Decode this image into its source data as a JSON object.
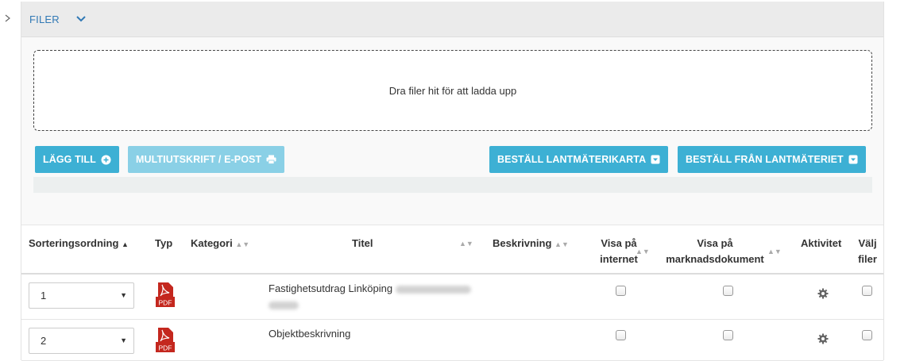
{
  "panel": {
    "title": "FILER"
  },
  "dropzone": {
    "text": "Dra filer hit för att ladda upp"
  },
  "toolbar": {
    "add_label": "LÄGG TILL",
    "multiprint_label": "MULTIUTSKRIFT / E-POST",
    "order_map_label": "BESTÄLL LANTMÄTERIKARTA",
    "order_lm_label": "BESTÄLL FRÅN LANTMÄTERIET"
  },
  "table": {
    "headers": {
      "sort_order": "Sorteringsordning",
      "type": "Typ",
      "category": "Kategori",
      "title": "Titel",
      "description": "Beskrivning",
      "visa_internet_1": "Visa på",
      "visa_internet_2": "internet",
      "visa_market_1": "Visa på",
      "visa_market_2": "marknadsdokument",
      "activity": "Aktivitet",
      "select_1": "Välj",
      "select_2": "filer"
    },
    "rows": [
      {
        "order": "1",
        "type": "PDF",
        "title": "Fastighetsutdrag Linköping"
      },
      {
        "order": "2",
        "type": "PDF",
        "title": "Objektbeskrivning"
      }
    ]
  },
  "colors": {
    "accent": "#3db0d4",
    "accent_disabled": "#8ad0e6",
    "title_blue": "#3179b5",
    "pdf_red": "#c4271e"
  }
}
